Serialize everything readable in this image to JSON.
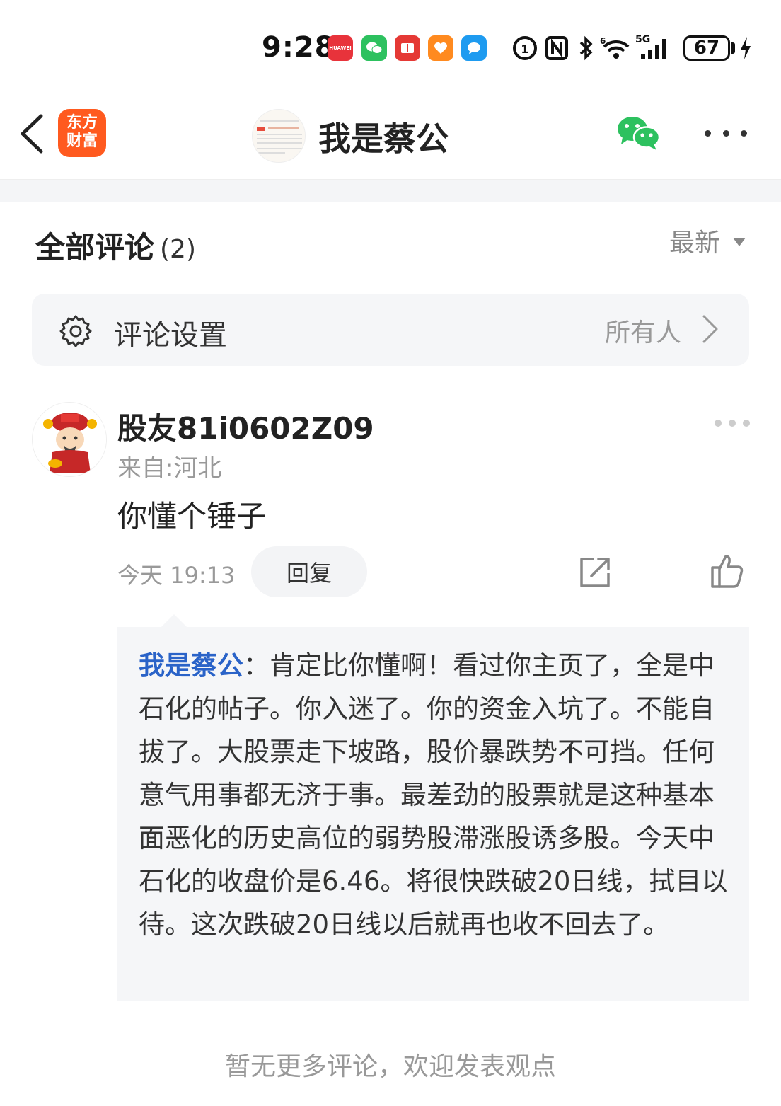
{
  "status_bar": {
    "time": "9:28",
    "battery": "67",
    "signal": "5G",
    "apps": [
      {
        "name": "huawei-store",
        "label": "HUAWEI",
        "color": "#e8333b"
      },
      {
        "name": "wechat",
        "label": "",
        "color": "#2dc15f"
      },
      {
        "name": "red-book",
        "label": "",
        "color": "#e53935"
      },
      {
        "name": "orange-app",
        "label": "",
        "color": "#ff8a1f"
      },
      {
        "name": "blue-chat",
        "label": "",
        "color": "#1e9bf0"
      }
    ]
  },
  "header": {
    "app_logo_line1": "东方",
    "app_logo_line2": "财富",
    "title": "我是蔡公"
  },
  "section": {
    "title": "全部评论",
    "count": "(2)",
    "sort_label": "最新"
  },
  "settings": {
    "label": "评论设置",
    "value": "所有人"
  },
  "comment": {
    "username": "股友81i0602Z09",
    "location": "来自:河北",
    "text": "你懂个锤子",
    "time": "今天 19:13",
    "reply_label": "回复"
  },
  "reply": {
    "author": "我是蔡公",
    "text": "：肯定比你懂啊！看过你主页了，全是中石化的帖子。你入迷了。你的资金入坑了。不能自拔了。大股票走下坡路，股价暴跌势不可挡。任何意气用事都无济于事。最差劲的股票就是这种基本面恶化的历史高位的弱势股滞涨股诱多股。今天中石化的收盘价是6.46。将很快跌破20日线，拭目以待。这次跌破20日线以后就再也收不回去了。"
  },
  "footer": {
    "note": "暂无更多评论，欢迎发表观点"
  }
}
